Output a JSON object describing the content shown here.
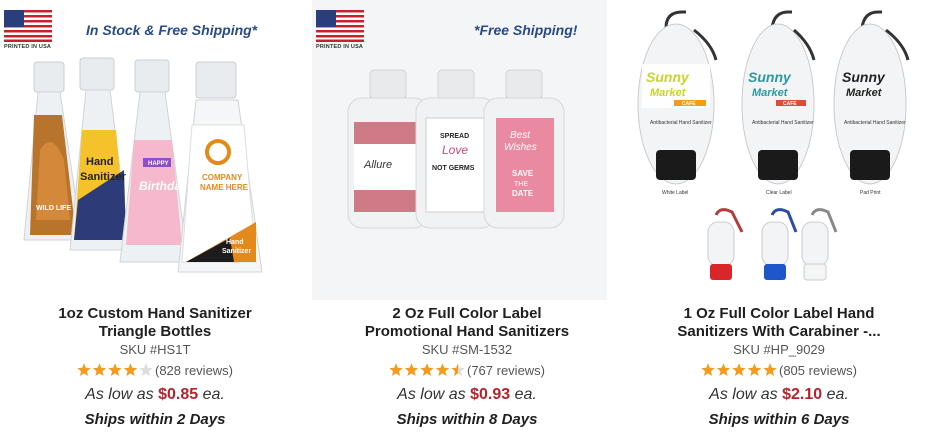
{
  "products": [
    {
      "banner": "In Stock & Free Shipping*",
      "flag_caption": "PRINTED IN USA",
      "title_line1": "1oz Custom Hand Sanitizer",
      "title_line2": "Triangle Bottles",
      "sku": "SKU #HS1T",
      "stars": 4,
      "reviews": "(828 reviews)",
      "price_prefix": "As low as",
      "price": "$0.85",
      "price_suffix": "ea.",
      "ships": "Ships within 2 Days",
      "labels": {
        "fox": "WILD LIFE",
        "hand": "Hand",
        "sanitizer": "Sanitizer",
        "happy": "HAPPY",
        "birthday": "Birthday",
        "company": "COMPANY",
        "name_here": "NAME HERE",
        "hand2": "Hand",
        "sanitizer2": "Sanitizer"
      }
    },
    {
      "banner": "*Free Shipping!",
      "flag_caption": "PRINTED IN USA",
      "title_line1": "2 Oz Full Color Label",
      "title_line2": "Promotional Hand Sanitizers",
      "sku": "SKU #SM-1532",
      "stars": 4.5,
      "reviews": "(767 reviews)",
      "price_prefix": "As low as",
      "price": "$0.93",
      "price_suffix": "ea.",
      "ships": "Ships within 8 Days",
      "labels": {
        "allure": "Allure",
        "spread": "SPREAD",
        "love": "Love",
        "not_germs": "NOT GERMS",
        "best": "Best",
        "wishes": "Wishes",
        "save": "SAVE",
        "the": "THE",
        "date": "DATE"
      }
    },
    {
      "title_line1": "1 Oz Full Color Label Hand",
      "title_line2": "Sanitizers With Carabiner -...",
      "sku": "SKU #HP_9029",
      "stars": 5,
      "reviews": "(805 reviews)",
      "price_prefix": "As low as",
      "price": "$2.10",
      "price_suffix": "ea.",
      "ships": "Ships within 6 Days",
      "labels": {
        "sunny": "Sunny",
        "market": "Market",
        "cafe": "CAFE",
        "antibacterial": "Antibacterial Hand Sanitizer",
        "white_label": "White Label",
        "clear_label": "Clear Label",
        "pad_print": "Pad Print"
      }
    }
  ],
  "colors": {
    "price": "#b3232c",
    "star": "#f29b1e",
    "banner": "#2a4a8a"
  }
}
